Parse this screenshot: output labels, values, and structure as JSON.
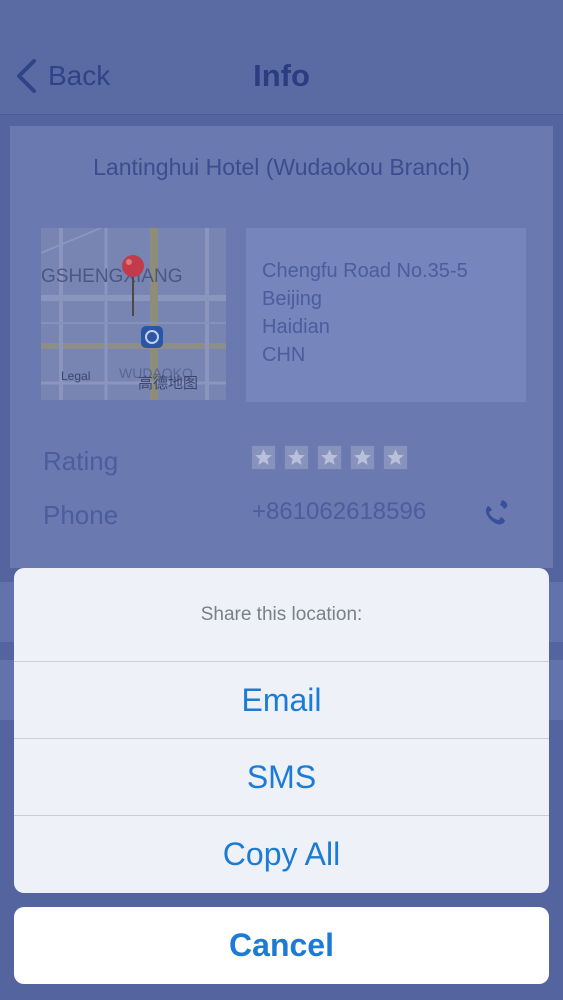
{
  "nav": {
    "back_label": "Back",
    "title": "Info"
  },
  "hotel": {
    "name": "Lantinghui Hotel (Wudaokou Branch)",
    "address_lines": [
      "Chengfu Road No.35-5",
      "Beijing",
      "Haidian",
      "CHN"
    ],
    "rating_label": "Rating",
    "rating_stars": 5,
    "phone_label": "Phone",
    "phone_number": "+861062618596"
  },
  "map": {
    "label_district": "GSHENGXIANG",
    "label_area": "WUDAOKO",
    "legal": "Legal",
    "provider": "高德地图"
  },
  "sheet": {
    "title": "Share this location:",
    "options": [
      "Email",
      "SMS",
      "Copy All"
    ],
    "cancel": "Cancel"
  },
  "colors": {
    "accent": "#1b7bd6",
    "nav": "#5a6aa3"
  }
}
